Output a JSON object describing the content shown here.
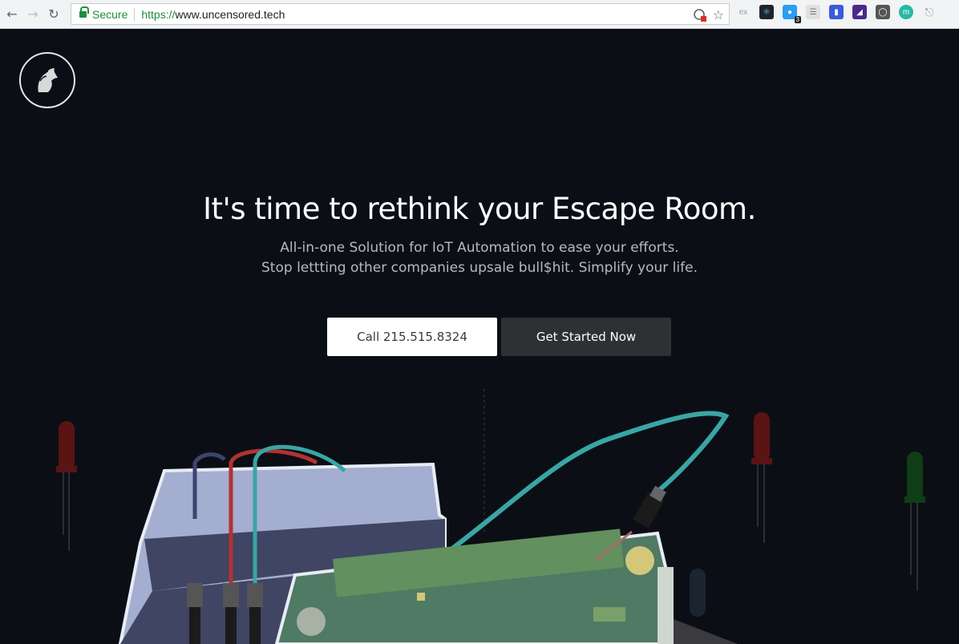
{
  "browser": {
    "secure_label": "Secure",
    "url_scheme": "https://",
    "url_host": "www.uncensored.tech",
    "extension_badge": "3",
    "extension_ex_label": "ex",
    "extension_m_label": "m"
  },
  "hero": {
    "title": "It's time to rethink your Escape Room.",
    "subtitle_line1": "All-in-one Solution for IoT Automation to ease your efforts.",
    "subtitle_line2": "Stop lettting other companies upsale bull$hit. Simplify your life."
  },
  "buttons": {
    "call_label": "Call 215.515.8324",
    "start_label": "Get Started Now"
  },
  "colors": {
    "background": "#0b0f15",
    "accent_teal": "#3aa5a5",
    "board_green": "#4f7a64",
    "breadboard": "#a4aed0"
  }
}
